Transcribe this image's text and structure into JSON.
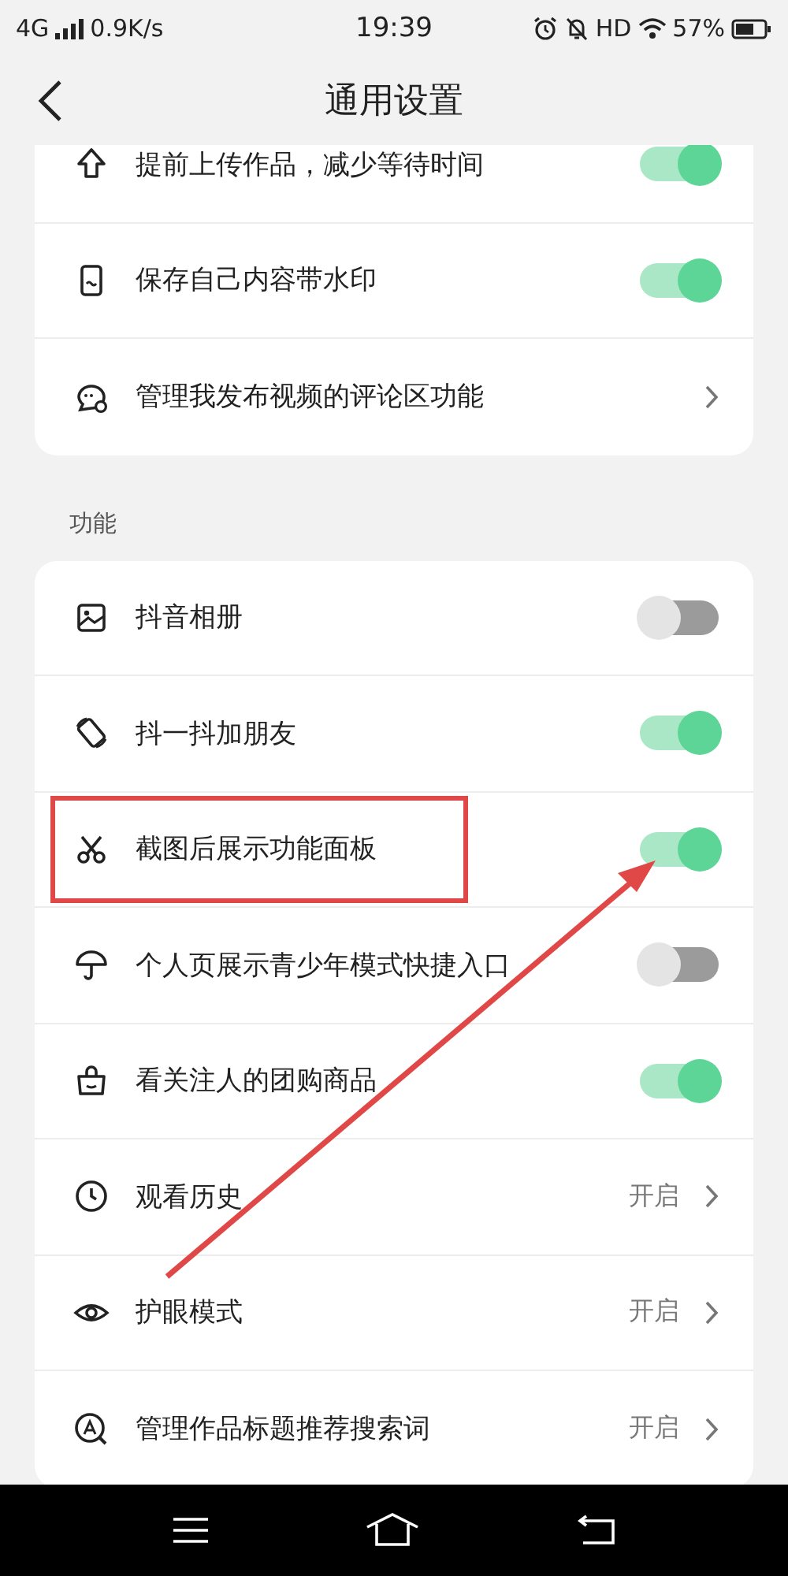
{
  "status_bar": {
    "network": "4G",
    "speed": "0.9K/s",
    "time": "19:39",
    "hd": "HD",
    "battery": "57%"
  },
  "header": {
    "title": "通用设置"
  },
  "sections": [
    {
      "items": [
        {
          "kind": "toggle",
          "label": "提前上传作品，减少等待时间",
          "on": true
        },
        {
          "kind": "toggle",
          "label": "保存自己内容带水印",
          "on": true
        },
        {
          "kind": "link",
          "label": "管理我发布视频的评论区功能"
        }
      ]
    },
    {
      "title": "功能",
      "items": [
        {
          "kind": "toggle",
          "label": "抖音相册",
          "on": false
        },
        {
          "kind": "toggle",
          "label": "抖一抖加朋友",
          "on": true
        },
        {
          "kind": "toggle",
          "label": "截图后展示功能面板",
          "on": true,
          "annotated": true
        },
        {
          "kind": "toggle",
          "label": "个人页展示青少年模式快捷入口",
          "on": false
        },
        {
          "kind": "toggle",
          "label": "看关注人的团购商品",
          "on": true
        },
        {
          "kind": "link",
          "label": "观看历史",
          "value": "开启"
        },
        {
          "kind": "link",
          "label": "护眼模式",
          "value": "开启"
        },
        {
          "kind": "link",
          "label": "管理作品标题推荐搜索词",
          "value": "开启"
        }
      ]
    }
  ]
}
